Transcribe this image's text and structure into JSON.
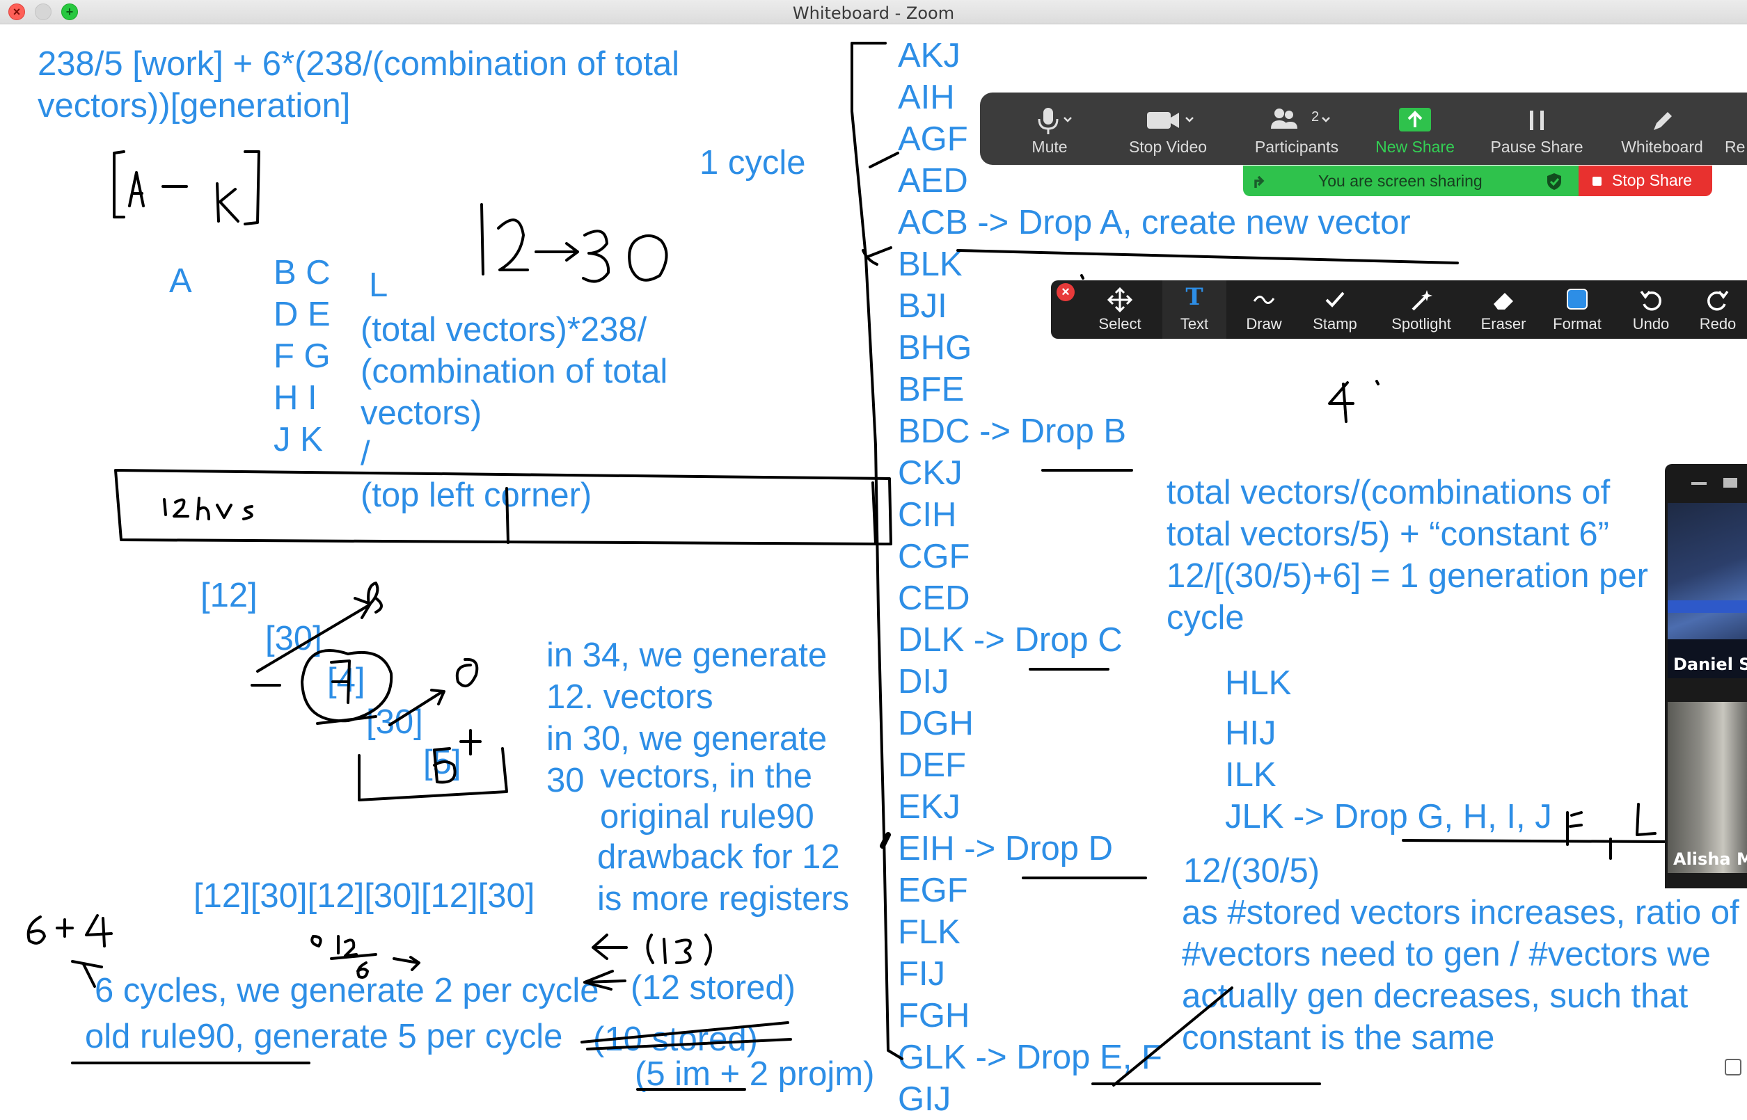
{
  "window": {
    "title": "Whiteboard - Zoom"
  },
  "whiteboard": {
    "formula_lines": [
      "238/5 [work] + 6*(238/(combination of total",
      "vectors))[generation]"
    ],
    "cycle_label": "1 cycle",
    "letters": {
      "a": "A",
      "l": "L",
      "pairs": [
        "B C",
        "D E",
        "F G",
        "H I",
        "J K"
      ]
    },
    "total_vectors_expr": [
      "(total vectors)*238/",
      "(combination of total",
      "vectors)",
      "/",
      "(top left corner)"
    ],
    "bracket_12": "[12]",
    "bracket_30a": "[30]",
    "bracket_4": "[4]",
    "bracket_30b": "[30]",
    "bracket_5": "[5]",
    "generation_notes": [
      "in 34, we generate",
      "12.  vectors",
      "in 30, we generate",
      "30",
      "vectors, in the",
      "original rule90",
      "drawback for 12",
      "is more registers"
    ],
    "sequence": "[12][30][12][30][12][30]",
    "cycles_note": "6 cycles, we generate 2 per cycle",
    "old_rule_note": "old rule90, generate 5 per cycle",
    "stored_12": "(12 stored)",
    "stored_10": "(10 stored)",
    "im_projm": "(5 im + 2 projm)",
    "vector_list": [
      "AKJ",
      "AIH",
      "AGF",
      "AED",
      "ACB -> Drop A, create new vector",
      "BLK",
      "BJI",
      "BHG",
      "BFE",
      "BDC -> Drop B",
      "CKJ",
      "CIH",
      "CGF",
      "CED",
      "DLK -> Drop C",
      "DIJ",
      "DGH",
      "DEF",
      "EKJ",
      "EIH -> Drop D",
      "EGF",
      "FLK",
      "FIJ",
      "FGH",
      "GLK -> Drop E, F",
      "GIJ"
    ],
    "right_note": [
      "total vectors/(combinations of",
      "total vectors/5) + “constant 6”",
      "12/[(30/5)+6] = 1 generation per",
      "cycle"
    ],
    "hlk_list": [
      "HLK",
      "HIJ",
      "ILK",
      "JLK -> Drop G, H, I, J"
    ],
    "ratio_note": [
      "12/(30/5)",
      "as #stored vectors increases, ratio of",
      "#vectors need to gen / #vectors we",
      "actually gen decreases, such that",
      "constant is the same"
    ]
  },
  "meeting_toolbar": {
    "mute": "Mute",
    "stop_video": "Stop Video",
    "participants": "Participants",
    "participant_count": "2",
    "new_share": "New Share",
    "pause_share": "Pause Share",
    "whiteboard": "Whiteboard",
    "more": "Re"
  },
  "sharing": {
    "status": "You are screen sharing",
    "stop": "Stop Share"
  },
  "annotation_toolbar": {
    "select": "Select",
    "text": "Text",
    "draw": "Draw",
    "stamp": "Stamp",
    "spotlight": "Spotlight",
    "eraser": "Eraser",
    "format": "Format",
    "undo": "Undo",
    "redo": "Redo"
  },
  "video_panel": {
    "participant_1": "Daniel Su",
    "participant_2": "Alisha Me"
  },
  "colors": {
    "ink_blue": "#2d8ee6",
    "share_green": "#2fc24c",
    "stop_red": "#e8312f",
    "toolbar": "#3c3c3c"
  }
}
